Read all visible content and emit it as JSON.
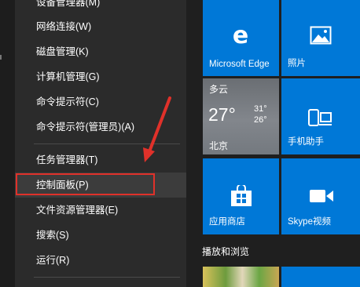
{
  "winx_menu": {
    "items": [
      {
        "label": "设备管理器(M)"
      },
      {
        "label": "网络连接(W)"
      },
      {
        "label": "磁盘管理(K)"
      },
      {
        "label": "计算机管理(G)"
      },
      {
        "label": "命令提示符(C)"
      },
      {
        "label": "命令提示符(管理员)(A)"
      },
      {
        "label": "任务管理器(T)"
      },
      {
        "label": "控制面板(P)"
      },
      {
        "label": "文件资源管理器(E)"
      },
      {
        "label": "搜索(S)"
      },
      {
        "label": "运行(R)"
      }
    ]
  },
  "tiles": {
    "edge": {
      "label": "Microsoft Edge",
      "icon": "edge-icon"
    },
    "photos": {
      "label": "照片",
      "icon": "photos-icon"
    },
    "weather": {
      "condition": "多云",
      "temp": "27°",
      "high": "31°",
      "low": "26°",
      "location": "北京"
    },
    "phone": {
      "label": "手机助手",
      "icon": "phone-icon"
    },
    "store": {
      "label": "应用商店",
      "icon": "store-icon"
    },
    "skype": {
      "label": "Skype视频",
      "icon": "video-camera-icon"
    }
  },
  "section": {
    "title": "播放和浏览"
  },
  "colors": {
    "tile": "#0078d7",
    "menu_bg": "#2b2b2b",
    "highlight_border": "#e0312a"
  }
}
